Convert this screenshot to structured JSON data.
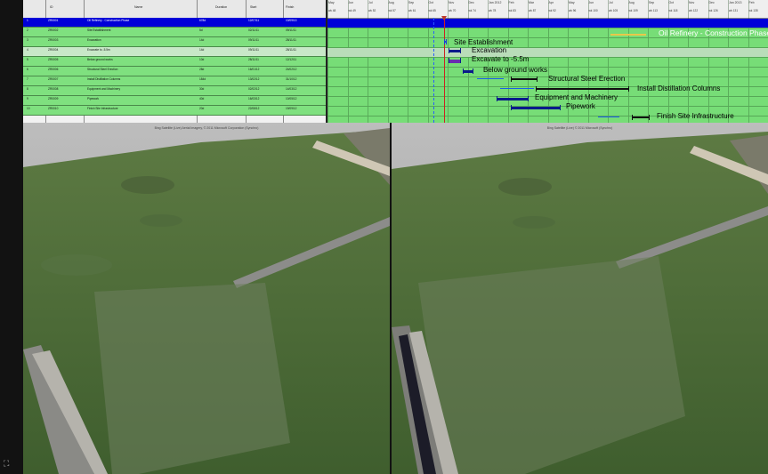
{
  "gantt": {
    "columns": [
      "ID",
      "Name",
      "Duration",
      "Start",
      "Finish"
    ],
    "months": [
      "May",
      "Jun",
      "Jul",
      "Aug",
      "Sep",
      "Oct",
      "Nov",
      "Dec",
      "Jan 2012",
      "Feb",
      "Mar",
      "Apr",
      "May",
      "Jun",
      "Jul",
      "Aug",
      "Sep",
      "Oct",
      "Nov",
      "Dec",
      "Jan 2013",
      "Feb"
    ],
    "weeks": [
      "wk 48",
      "wk 49",
      "wk 52",
      "wk 57",
      "wk 61",
      "wk 65",
      "wk 70",
      "wk 74",
      "wk 78",
      "wk 83",
      "wk 87",
      "wk 92",
      "wk 96",
      "wk 100",
      "wk 105",
      "wk 109",
      "wk 113",
      "wk 118",
      "wk 122",
      "wk 126",
      "wk 131",
      "wk 135"
    ],
    "rows": [
      {
        "id": "1",
        "code": "ZR0001",
        "name": "Oil Refinery - Construction Phase",
        "duration": "678d",
        "start": "12/07/11",
        "finish": "10/09/13"
      },
      {
        "id": "2",
        "code": "ZR0002",
        "name": "Site Establishment",
        "duration": "5d",
        "start": "02/11/11",
        "finish": "09/11/11"
      },
      {
        "id": "3",
        "code": "ZR0003",
        "name": "Excavation",
        "duration": "14d",
        "start": "09/11/11",
        "finish": "28/11/11"
      },
      {
        "id": "4",
        "code": "ZR0004",
        "name": "Excavate to -5.5m",
        "duration": "14d",
        "start": "09/11/11",
        "finish": "28/11/11"
      },
      {
        "id": "5",
        "code": "ZR0005",
        "name": "Below ground works",
        "duration": "10d",
        "start": "28/11/11",
        "finish": "12/12/11"
      },
      {
        "id": "6",
        "code": "ZR0006",
        "name": "Structural Steel Erection",
        "duration": "28d",
        "start": "16/01/12",
        "finish": "24/02/12"
      },
      {
        "id": "7",
        "code": "ZR0007",
        "name": "Install Distillation Columns",
        "duration": "184d",
        "start": "13/02/12",
        "finish": "31/10/12"
      },
      {
        "id": "8",
        "code": "ZR0008",
        "name": "Equipment and Machinery",
        "duration": "30d",
        "start": "02/02/12",
        "finish": "14/03/12"
      },
      {
        "id": "9",
        "code": "ZR0009",
        "name": "Pipework",
        "duration": "40d",
        "start": "16/03/12",
        "finish": "10/05/12"
      },
      {
        "id": "10",
        "code": "ZR0010",
        "name": "Finish Site Infrastructure",
        "duration": "20d",
        "start": "22/08/12",
        "finish": "19/09/12"
      }
    ],
    "bar_labels": [
      "Oil Refinery - Construction Phase",
      "Site Establishment",
      "Excavation",
      "Excavate to -5.5m",
      "Below ground works",
      "Structural Steel Erection",
      "Install Distillation Columns",
      "Equipment and Machinery",
      "Pipework",
      "Finish Site Infrastructure"
    ]
  },
  "views": {
    "left_caption": "Bing Satellite (Live) Aerial Imagery, © 2011 Microsoft Corporation (Synchro)",
    "right_caption": "Bing Satellite (Live) © 2011 Microsoft (Synchro)"
  },
  "corner_icon": "expand-icon",
  "colors": {
    "summary_bar": "#0000d8",
    "task_row": "#7fe07f",
    "today_line": "#cc2222"
  }
}
